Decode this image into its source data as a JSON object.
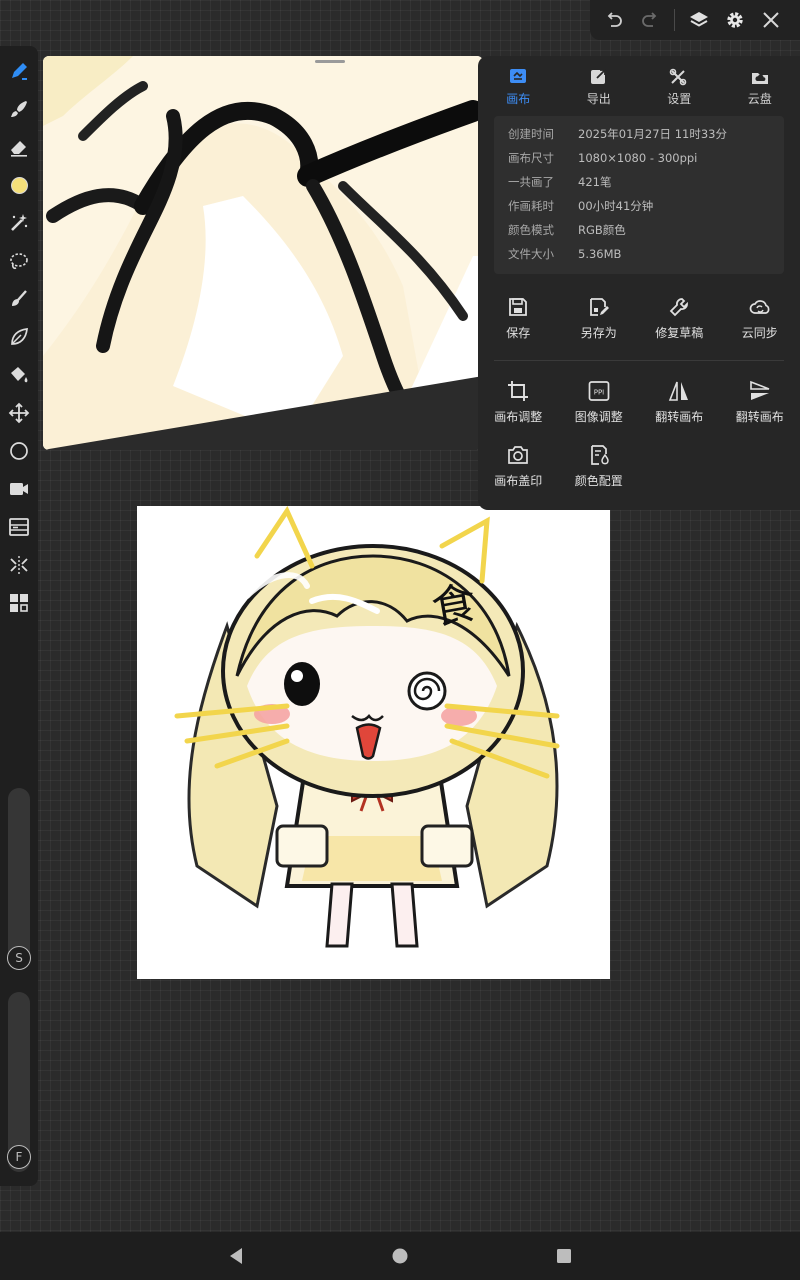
{
  "panel": {
    "tabs": [
      {
        "label": "画布",
        "icon": "canvas-icon",
        "active": true
      },
      {
        "label": "导出",
        "icon": "export-icon",
        "active": false
      },
      {
        "label": "设置",
        "icon": "settings-tools-icon",
        "active": false
      },
      {
        "label": "云盘",
        "icon": "cloud-drive-icon",
        "active": false
      }
    ],
    "info": [
      {
        "key": "创建时间",
        "value": "2025年01月27日 11时33分"
      },
      {
        "key": "画布尺寸",
        "value": "1080×1080 - 300ppi"
      },
      {
        "key": "一共画了",
        "value": "421笔"
      },
      {
        "key": "作画耗时",
        "value": "00小时41分钟"
      },
      {
        "key": "颜色模式",
        "value": "RGB颜色"
      },
      {
        "key": "文件大小",
        "value": "5.36MB"
      }
    ],
    "actions_row1": [
      {
        "label": "保存",
        "icon": "save-icon"
      },
      {
        "label": "另存为",
        "icon": "save-as-icon"
      },
      {
        "label": "修复草稿",
        "icon": "wrench-icon"
      },
      {
        "label": "云同步",
        "icon": "cloud-sync-icon"
      }
    ],
    "actions_row2": [
      {
        "label": "画布调整",
        "icon": "crop-icon"
      },
      {
        "label": "图像调整",
        "icon": "ppi-icon"
      },
      {
        "label": "翻转画布",
        "icon": "flip-horizontal-icon"
      },
      {
        "label": "翻转画布",
        "icon": "flip-vertical-icon"
      }
    ],
    "actions_row3": [
      {
        "label": "画布盖印",
        "icon": "camera-stamp-icon"
      },
      {
        "label": "颜色配置",
        "icon": "color-profile-icon"
      }
    ]
  },
  "artwork": {
    "glyph": "食"
  },
  "toolbar": {
    "slider_s_label": "S",
    "slider_f_label": "F",
    "current_color": "#f5e07a",
    "accent_color": "#2f8df5"
  },
  "topbar": {
    "icons": [
      "undo-icon",
      "redo-icon",
      "layers-icon",
      "gear-icon",
      "close-icon"
    ]
  },
  "navbar": {
    "icons": [
      "back-icon",
      "home-icon",
      "recents-icon"
    ]
  }
}
